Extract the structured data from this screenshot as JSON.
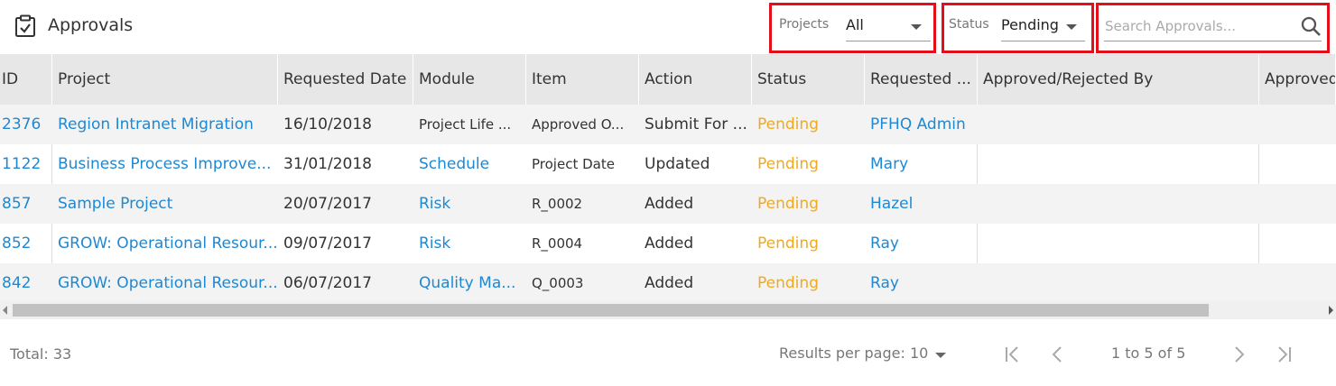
{
  "header": {
    "title": "Approvals",
    "projects_label": "Projects",
    "projects_value": "All",
    "status_label": "Status",
    "status_value": "Pending",
    "search_placeholder": "Search Approvals...",
    "highlight_color": "#e3101c"
  },
  "table": {
    "columns": [
      "ID",
      "Project",
      "Requested Date",
      "Module",
      "Item",
      "Action",
      "Status",
      "Requested ...",
      "Approved/Rejected By",
      "Approved"
    ],
    "rows": [
      {
        "id": "2376",
        "project": "Region Intranet Migration",
        "date": "16/10/2018",
        "module": "Project Life ...",
        "item": "Approved O...",
        "action": "Submit For ...",
        "status": "Pending",
        "requested_by": "PFHQ Admin",
        "approved_by": "",
        "approved": ""
      },
      {
        "id": "1122",
        "project": "Business Process Improve...",
        "date": "31/01/2018",
        "module": "Schedule",
        "item": "Project Date",
        "action": "Updated",
        "status": "Pending",
        "requested_by": "Mary",
        "approved_by": "",
        "approved": ""
      },
      {
        "id": "857",
        "project": "Sample Project",
        "date": "20/07/2017",
        "module": "Risk",
        "item": "R_0002",
        "action": "Added",
        "status": "Pending",
        "requested_by": "Hazel",
        "approved_by": "",
        "approved": ""
      },
      {
        "id": "852",
        "project": "GROW: Operational Resour...",
        "date": "09/07/2017",
        "module": "Risk",
        "item": "R_0004",
        "action": "Added",
        "status": "Pending",
        "requested_by": "Ray",
        "approved_by": "",
        "approved": ""
      },
      {
        "id": "842",
        "project": "GROW: Operational Resour...",
        "date": "06/07/2017",
        "module": "Quality Ma...",
        "item": "Q_0003",
        "action": "Added",
        "status": "Pending",
        "requested_by": "Ray",
        "approved_by": "",
        "approved": ""
      }
    ],
    "link_color": "#1e88d2",
    "pending_color": "#f0a91e"
  },
  "footer": {
    "total": "Total: 33",
    "results_per_page": "Results per page: 10",
    "page_range": "1 to 5 of 5"
  }
}
